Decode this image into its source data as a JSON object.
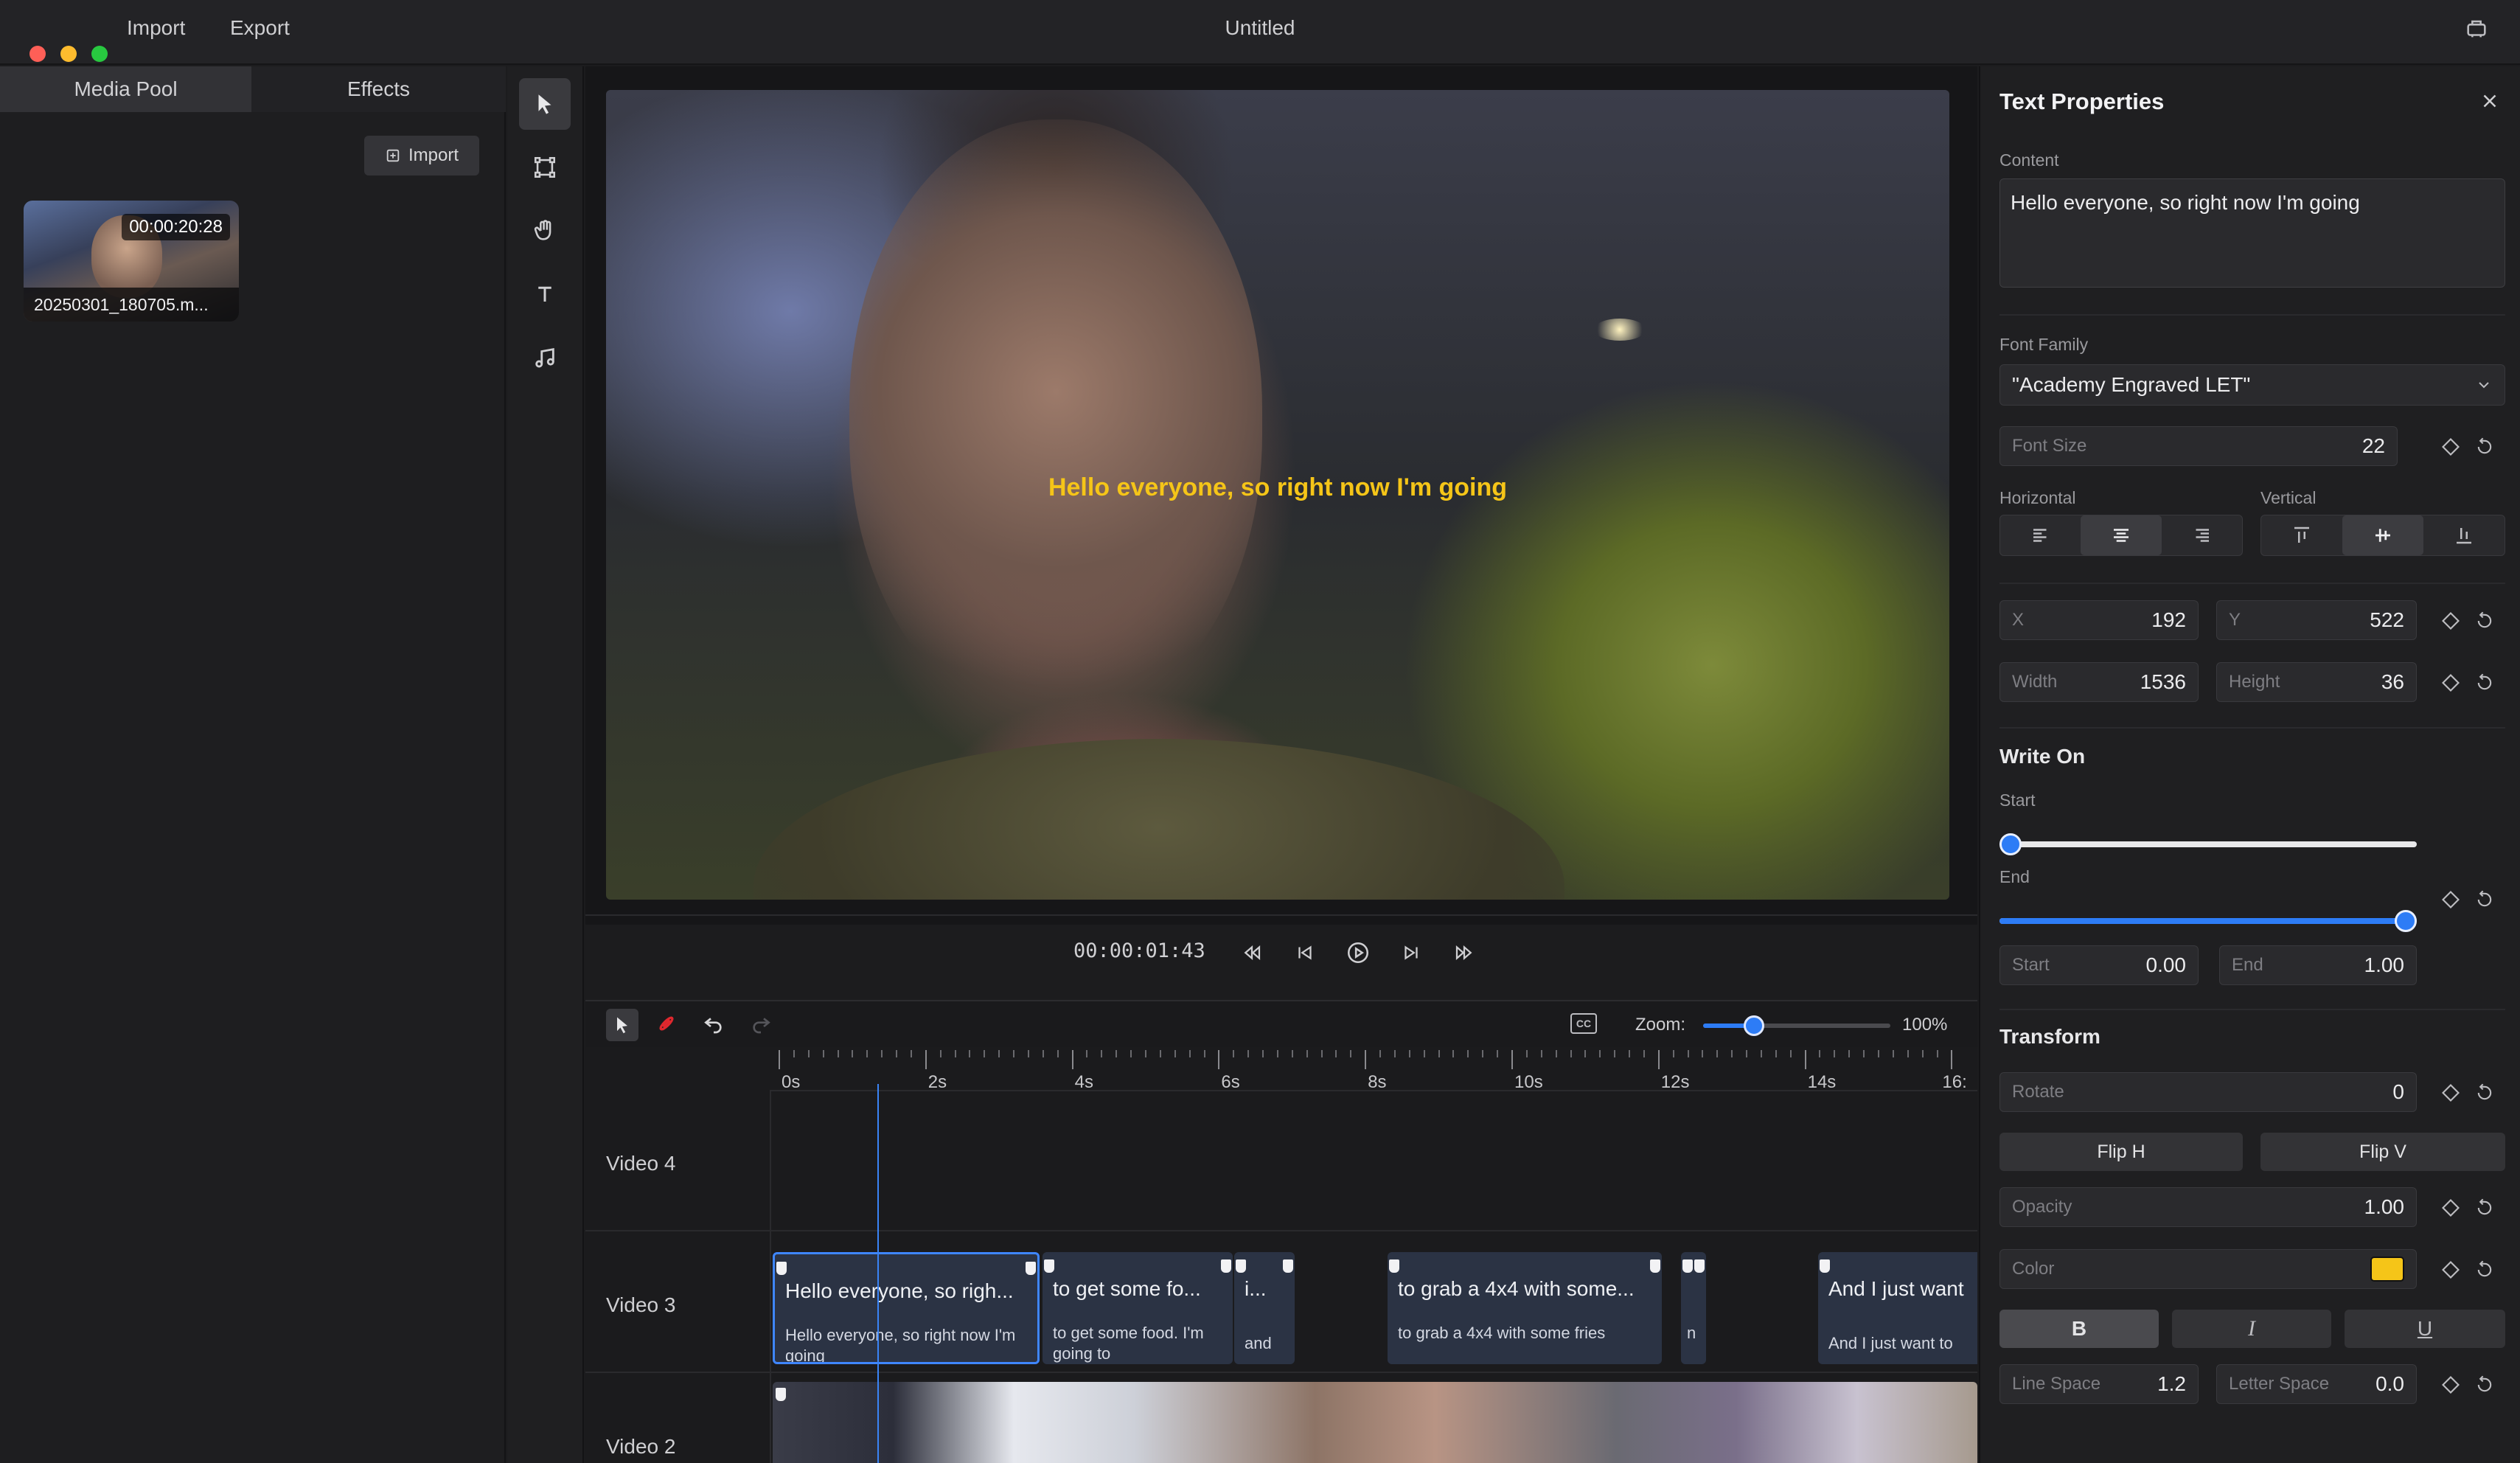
{
  "app": {
    "title": "Untitled",
    "menu": [
      "Import",
      "Export"
    ]
  },
  "left_panel": {
    "tabs": [
      "Media Pool",
      "Effects"
    ],
    "import_label": "Import",
    "media": [
      {
        "duration": "00:00:20:28",
        "name": "20250301_180705.m..."
      }
    ]
  },
  "preview": {
    "subtitle": "Hello everyone, so right now I'm going",
    "timecode": "00:00:01:43"
  },
  "timeline_toolbar": {
    "cc_label": "CC",
    "zoom_label": "Zoom:",
    "zoom_value": "100%",
    "zoom_fraction": 0.27
  },
  "timeline": {
    "ruler_labels": [
      "0s",
      "2s",
      "4s",
      "6s",
      "8s",
      "10s",
      "12s",
      "14s",
      "16:"
    ],
    "tracks": [
      "Video 4",
      "Video 3",
      "Video 2"
    ],
    "text_clips": [
      {
        "title": "Hello everyone, so righ...",
        "body": "Hello everyone, so right now I'm going"
      },
      {
        "title": "to get some fo...",
        "body": "to get some food. I'm going to"
      },
      {
        "title": "i...",
        "body": "and"
      },
      {
        "title": "to grab a 4x4 with some...",
        "body": "to grab a 4x4 with some fries"
      },
      {
        "title": "",
        "body": "n"
      },
      {
        "title": "And I just want",
        "body": "And I just want to"
      }
    ]
  },
  "props": {
    "title": "Text Properties",
    "content_label": "Content",
    "content_value": "Hello everyone, so right now I'm going",
    "font_family_label": "Font Family",
    "font_family_value": "\"Academy Engraved LET\"",
    "font_size_label": "Font Size",
    "font_size_value": "22",
    "horizontal_label": "Horizontal",
    "vertical_label": "Vertical",
    "x_label": "X",
    "x_value": "192",
    "y_label": "Y",
    "y_value": "522",
    "width_label": "Width",
    "width_value": "1536",
    "height_label": "Height",
    "height_value": "36",
    "write_on_title": "Write On",
    "start_label": "Start",
    "end_label": "End",
    "start_fraction": 0.0,
    "end_fraction": 1.0,
    "start_value": "0.00",
    "end_value": "1.00",
    "transform_title": "Transform",
    "rotate_label": "Rotate",
    "rotate_value": "0",
    "flip_h": "Flip H",
    "flip_v": "Flip V",
    "opacity_label": "Opacity",
    "opacity_value": "1.00",
    "color_label": "Color",
    "text_color": "#f5c518",
    "bold": "B",
    "italic": "I",
    "underline": "U",
    "line_space_label": "Line Space",
    "line_space_value": "1.2",
    "letter_space_label": "Letter Space",
    "letter_space_value": "0.0"
  },
  "colors": {
    "accent": "#2d7cf6",
    "traffic_close": "#ff5f57",
    "traffic_min": "#febc2e",
    "traffic_max": "#28c840"
  }
}
